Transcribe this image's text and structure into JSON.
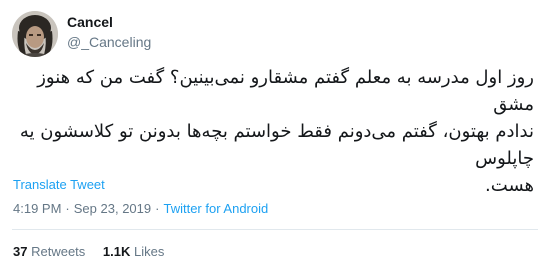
{
  "author": {
    "name": "Cancel",
    "handle": "@_Canceling"
  },
  "tweet": {
    "text": "روز اول مدرسه به معلم گفتم مشقارو نمی‌بینین؟ گفت من که هنوز مشق\nندادم بهتون، گفتم می‌دونم فقط خواستم بچه‌ها بدونن تو کلاسشون یه چاپلوس\nهست.",
    "translate_label": "Translate Tweet",
    "time": "4:19 PM",
    "separator": "·",
    "date": "Sep 23, 2019",
    "client": "Twitter for Android"
  },
  "stats": {
    "retweets_count": "37",
    "retweets_label": "Retweets",
    "likes_count": "1.1K",
    "likes_label": "Likes"
  },
  "colors": {
    "link": "#1da1f2",
    "secondary_text": "#657786",
    "primary_text": "#14171a",
    "divider": "#e1e8ed"
  }
}
